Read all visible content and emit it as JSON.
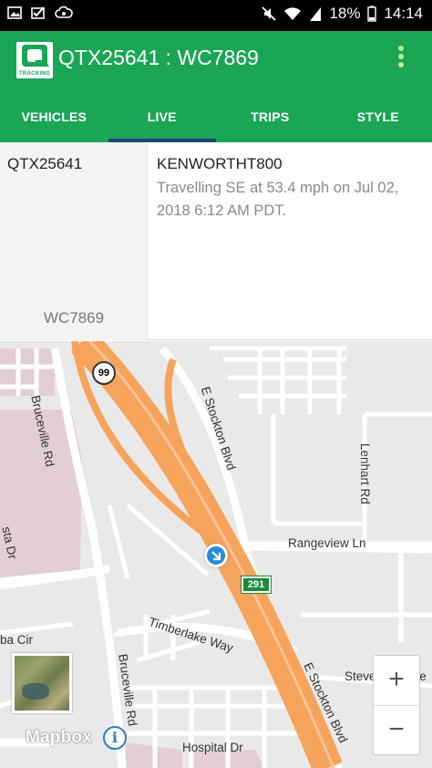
{
  "status_bar": {
    "left_icons": [
      "image-icon",
      "check-mail-icon",
      "cloud-sync-icon"
    ],
    "right_icons": [
      "mute-icon",
      "wifi-icon",
      "signal-icon"
    ],
    "battery": "18%",
    "time": "14:14"
  },
  "app_bar": {
    "logo_text": "TRACKING",
    "title": "QTX25641 : WC7869",
    "menu_icon": "overflow-menu-icon",
    "accent_color": "#1aa655"
  },
  "tabs": [
    {
      "label": "VEHICLES",
      "active": false
    },
    {
      "label": "LIVE",
      "active": true
    },
    {
      "label": "TRIPS",
      "active": false
    },
    {
      "label": "STYLE",
      "active": false
    }
  ],
  "vehicle_info": {
    "id": "QTX25641",
    "plate": "WC7869",
    "model": "KENWORTHT800",
    "status": "Travelling SE at 53.4 mph on Jul 02, 2018 6:12 AM PDT."
  },
  "map": {
    "labels": {
      "bruceville_rd_top": "Bruceville Rd",
      "bruceville_rd_bottom": "Bruceville Rd",
      "e_stockton_blvd_top": "E Stockton Blvd",
      "e_stockton_blvd_bottom": "E Stockton Blvd",
      "lenhart_rd": "Lenhart Rd",
      "rangeview_ln": "Rangeview Ln",
      "timberlake_way": "Timberlake Way",
      "stevenson_ave": "Stevenson Ave",
      "hospital_dr": "Hospital Dr",
      "alta_dr": "sta Dr",
      "aba_cir": "ba Cir"
    },
    "shields": {
      "route_99": "99",
      "route_291": "291"
    },
    "attribution": "Mapbox",
    "info_button": "i",
    "zoom_in": "+",
    "zoom_out": "−",
    "freeway_color": "#f6a45c"
  }
}
